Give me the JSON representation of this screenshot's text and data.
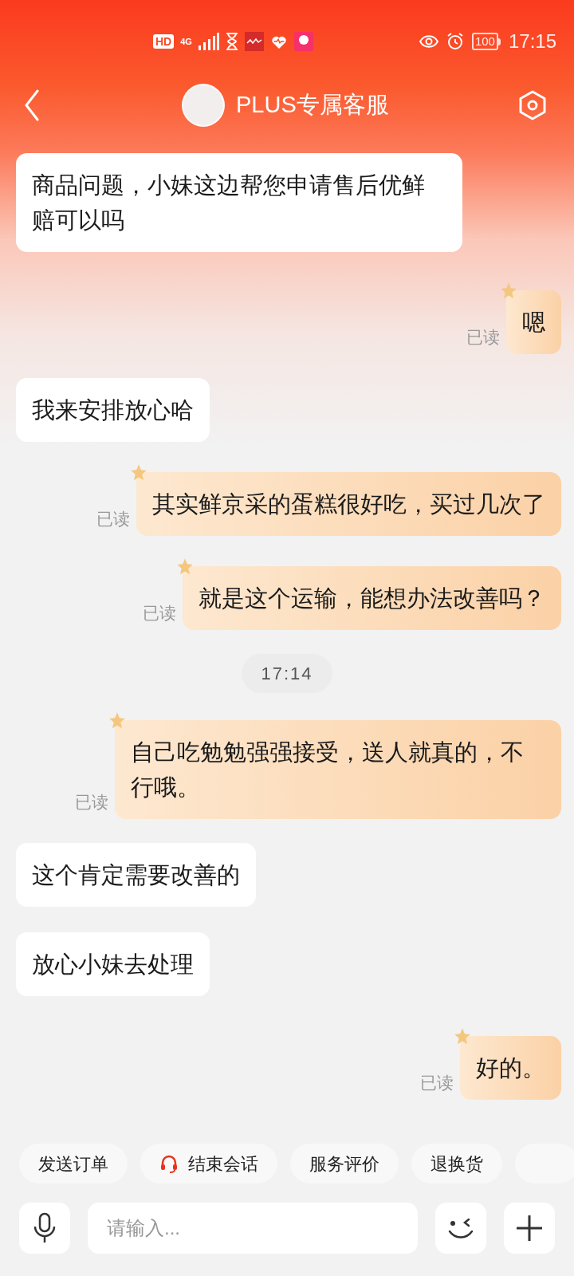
{
  "status_bar": {
    "hd": "HD",
    "network": "4G",
    "battery": "100",
    "time": "17:15"
  },
  "header": {
    "title": "PLUS专属客服"
  },
  "messages": [
    {
      "kind": "received",
      "text": "商品问题，小妹这边帮您申请售后优鲜赔可以吗"
    },
    {
      "kind": "sent",
      "text": "嗯",
      "status": "已读"
    },
    {
      "kind": "received",
      "text": "我来安排放心哈"
    },
    {
      "kind": "sent",
      "text": "其实鲜京采的蛋糕很好吃，买过几次了",
      "status": "已读"
    },
    {
      "kind": "sent",
      "text": "就是这个运输，能想办法改善吗？",
      "status": "已读"
    },
    {
      "kind": "timestamp",
      "text": "17:14"
    },
    {
      "kind": "sent",
      "text": "自己吃勉勉强强接受，送人就真的，不行哦。",
      "status": "已读"
    },
    {
      "kind": "received",
      "text": "这个肯定需要改善的"
    },
    {
      "kind": "received",
      "text": "放心小妹去处理"
    },
    {
      "kind": "sent",
      "text": "好的。",
      "status": "已读"
    }
  ],
  "quick_actions": [
    {
      "label": "发送订单",
      "kind": "plain"
    },
    {
      "label": "结束会话",
      "kind": "headset"
    },
    {
      "label": "服务评价",
      "kind": "plain"
    },
    {
      "label": "退换货",
      "kind": "plain"
    }
  ],
  "input": {
    "placeholder": "请输入..."
  }
}
